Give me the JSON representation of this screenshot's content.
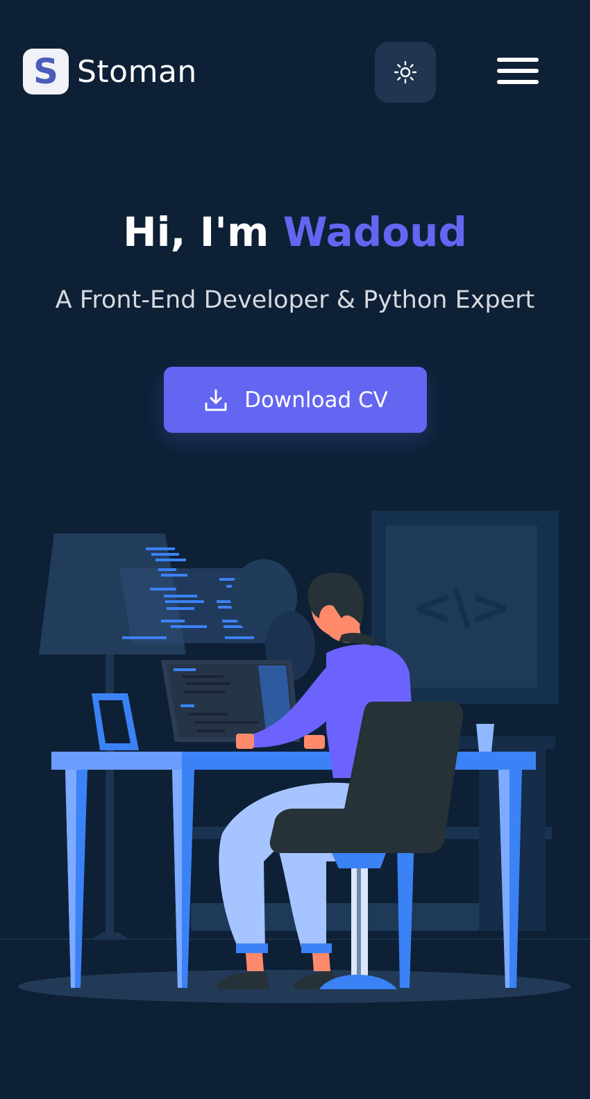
{
  "header": {
    "logo_letter": "S",
    "brand_name": "Stoman",
    "theme_toggle_icon": "sun-icon",
    "menu_icon": "hamburger-menu-icon"
  },
  "hero": {
    "greeting": "Hi, I'm ",
    "name": "Wadoud",
    "subtitle": "A Front-End Developer & Python Expert",
    "cta_label": "Download CV",
    "cta_icon": "download-icon"
  },
  "illustration": {
    "code_symbol": "<\\>",
    "icon": "developer-at-desk-illustration"
  },
  "colors": {
    "background": "#0e2036",
    "accent": "#6366f1",
    "button_surface": "#1f3550"
  }
}
